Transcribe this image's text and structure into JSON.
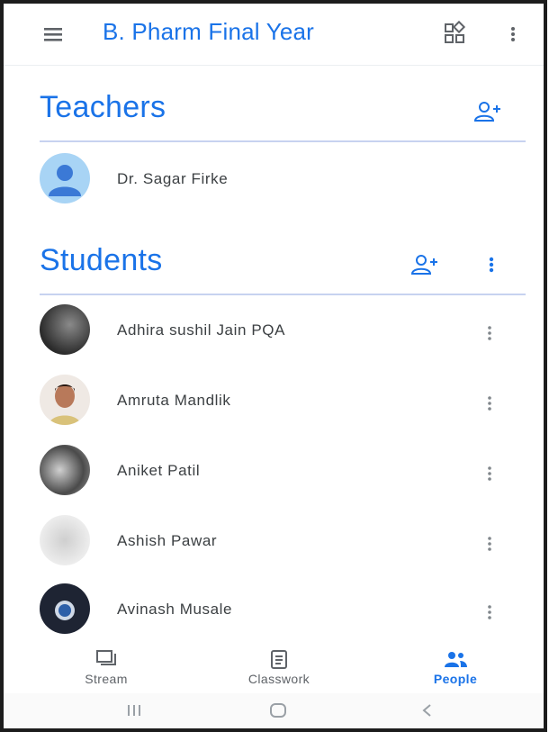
{
  "appbar": {
    "title": "B. Pharm Final Year",
    "menu_icon": "hamburger-menu-icon",
    "apps_icon": "classroom-apps-icon",
    "more_icon": "more-vert-icon"
  },
  "teachers": {
    "heading": "Teachers",
    "add_icon": "add-person-icon",
    "items": [
      {
        "name": "Dr. Sagar Firke",
        "avatar": "default-avatar"
      }
    ]
  },
  "students": {
    "heading": "Students",
    "add_icon": "add-person-icon",
    "more_icon": "more-vert-icon",
    "items": [
      {
        "name": "Adhira sushil Jain PQA",
        "avatar": "photo-avatar"
      },
      {
        "name": "Amruta Mandlik",
        "avatar": "photo-avatar"
      },
      {
        "name": "Aniket Patil",
        "avatar": "photo-avatar"
      },
      {
        "name": "Ashish Pawar",
        "avatar": "photo-avatar"
      },
      {
        "name": "Avinash Musale",
        "avatar": "photo-avatar"
      }
    ]
  },
  "bottom_nav": {
    "items": [
      {
        "label": "Stream",
        "icon": "stream-icon",
        "active": false
      },
      {
        "label": "Classwork",
        "icon": "classwork-icon",
        "active": false
      },
      {
        "label": "People",
        "icon": "people-icon",
        "active": true
      }
    ]
  },
  "system_nav": {
    "recents_icon": "recents-icon",
    "home_icon": "home-icon",
    "back_icon": "back-icon"
  },
  "colors": {
    "accent": "#1a73e8",
    "divider": "#c7d2f0",
    "text": "#3c4043"
  }
}
